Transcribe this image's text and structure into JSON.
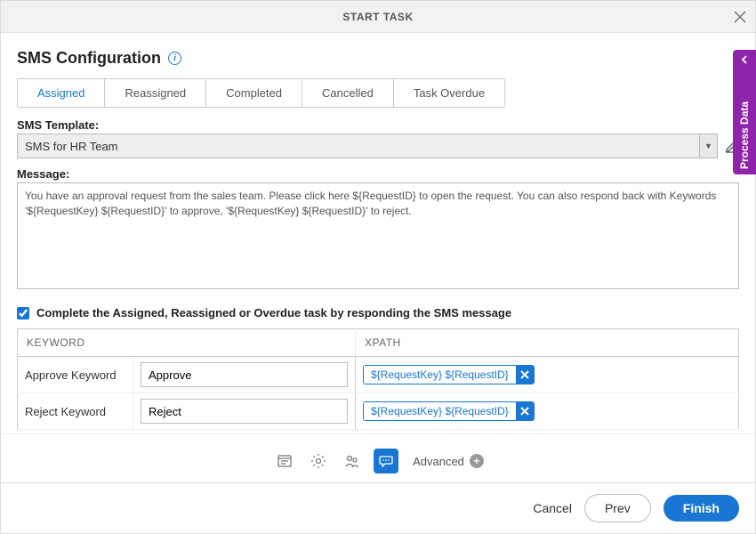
{
  "header": {
    "title": "START TASK"
  },
  "section": {
    "title": "SMS Configuration"
  },
  "tabs": [
    {
      "label": "Assigned",
      "active": true
    },
    {
      "label": "Reassigned",
      "active": false
    },
    {
      "label": "Completed",
      "active": false
    },
    {
      "label": "Cancelled",
      "active": false
    },
    {
      "label": "Task Overdue",
      "active": false
    }
  ],
  "template": {
    "label": "SMS Template:",
    "value": "SMS for HR Team"
  },
  "message": {
    "label": "Message:",
    "value": "You have an approval request from the sales team. Please click here ${RequestID} to open the request. You can also respond back with Keywords '${RequestKey} ${RequestID}' to approve, '${RequestKey} ${RequestID}' to reject."
  },
  "checkbox": {
    "label": "Complete the Assigned, Reassigned or Overdue task by responding the SMS message",
    "checked": true
  },
  "table": {
    "headers": {
      "keyword": "KEYWORD",
      "xpath": "XPATH"
    },
    "rows": [
      {
        "label": "Approve Keyword",
        "value": "Approve",
        "chip": "${RequestKey} ${RequestID}"
      },
      {
        "label": "Reject Keyword",
        "value": "Reject",
        "chip": "${RequestKey} ${RequestID}"
      }
    ]
  },
  "toolbar": {
    "advanced": "Advanced"
  },
  "footer": {
    "cancel": "Cancel",
    "prev": "Prev",
    "finish": "Finish"
  },
  "sideTab": {
    "label": "Process Data"
  }
}
